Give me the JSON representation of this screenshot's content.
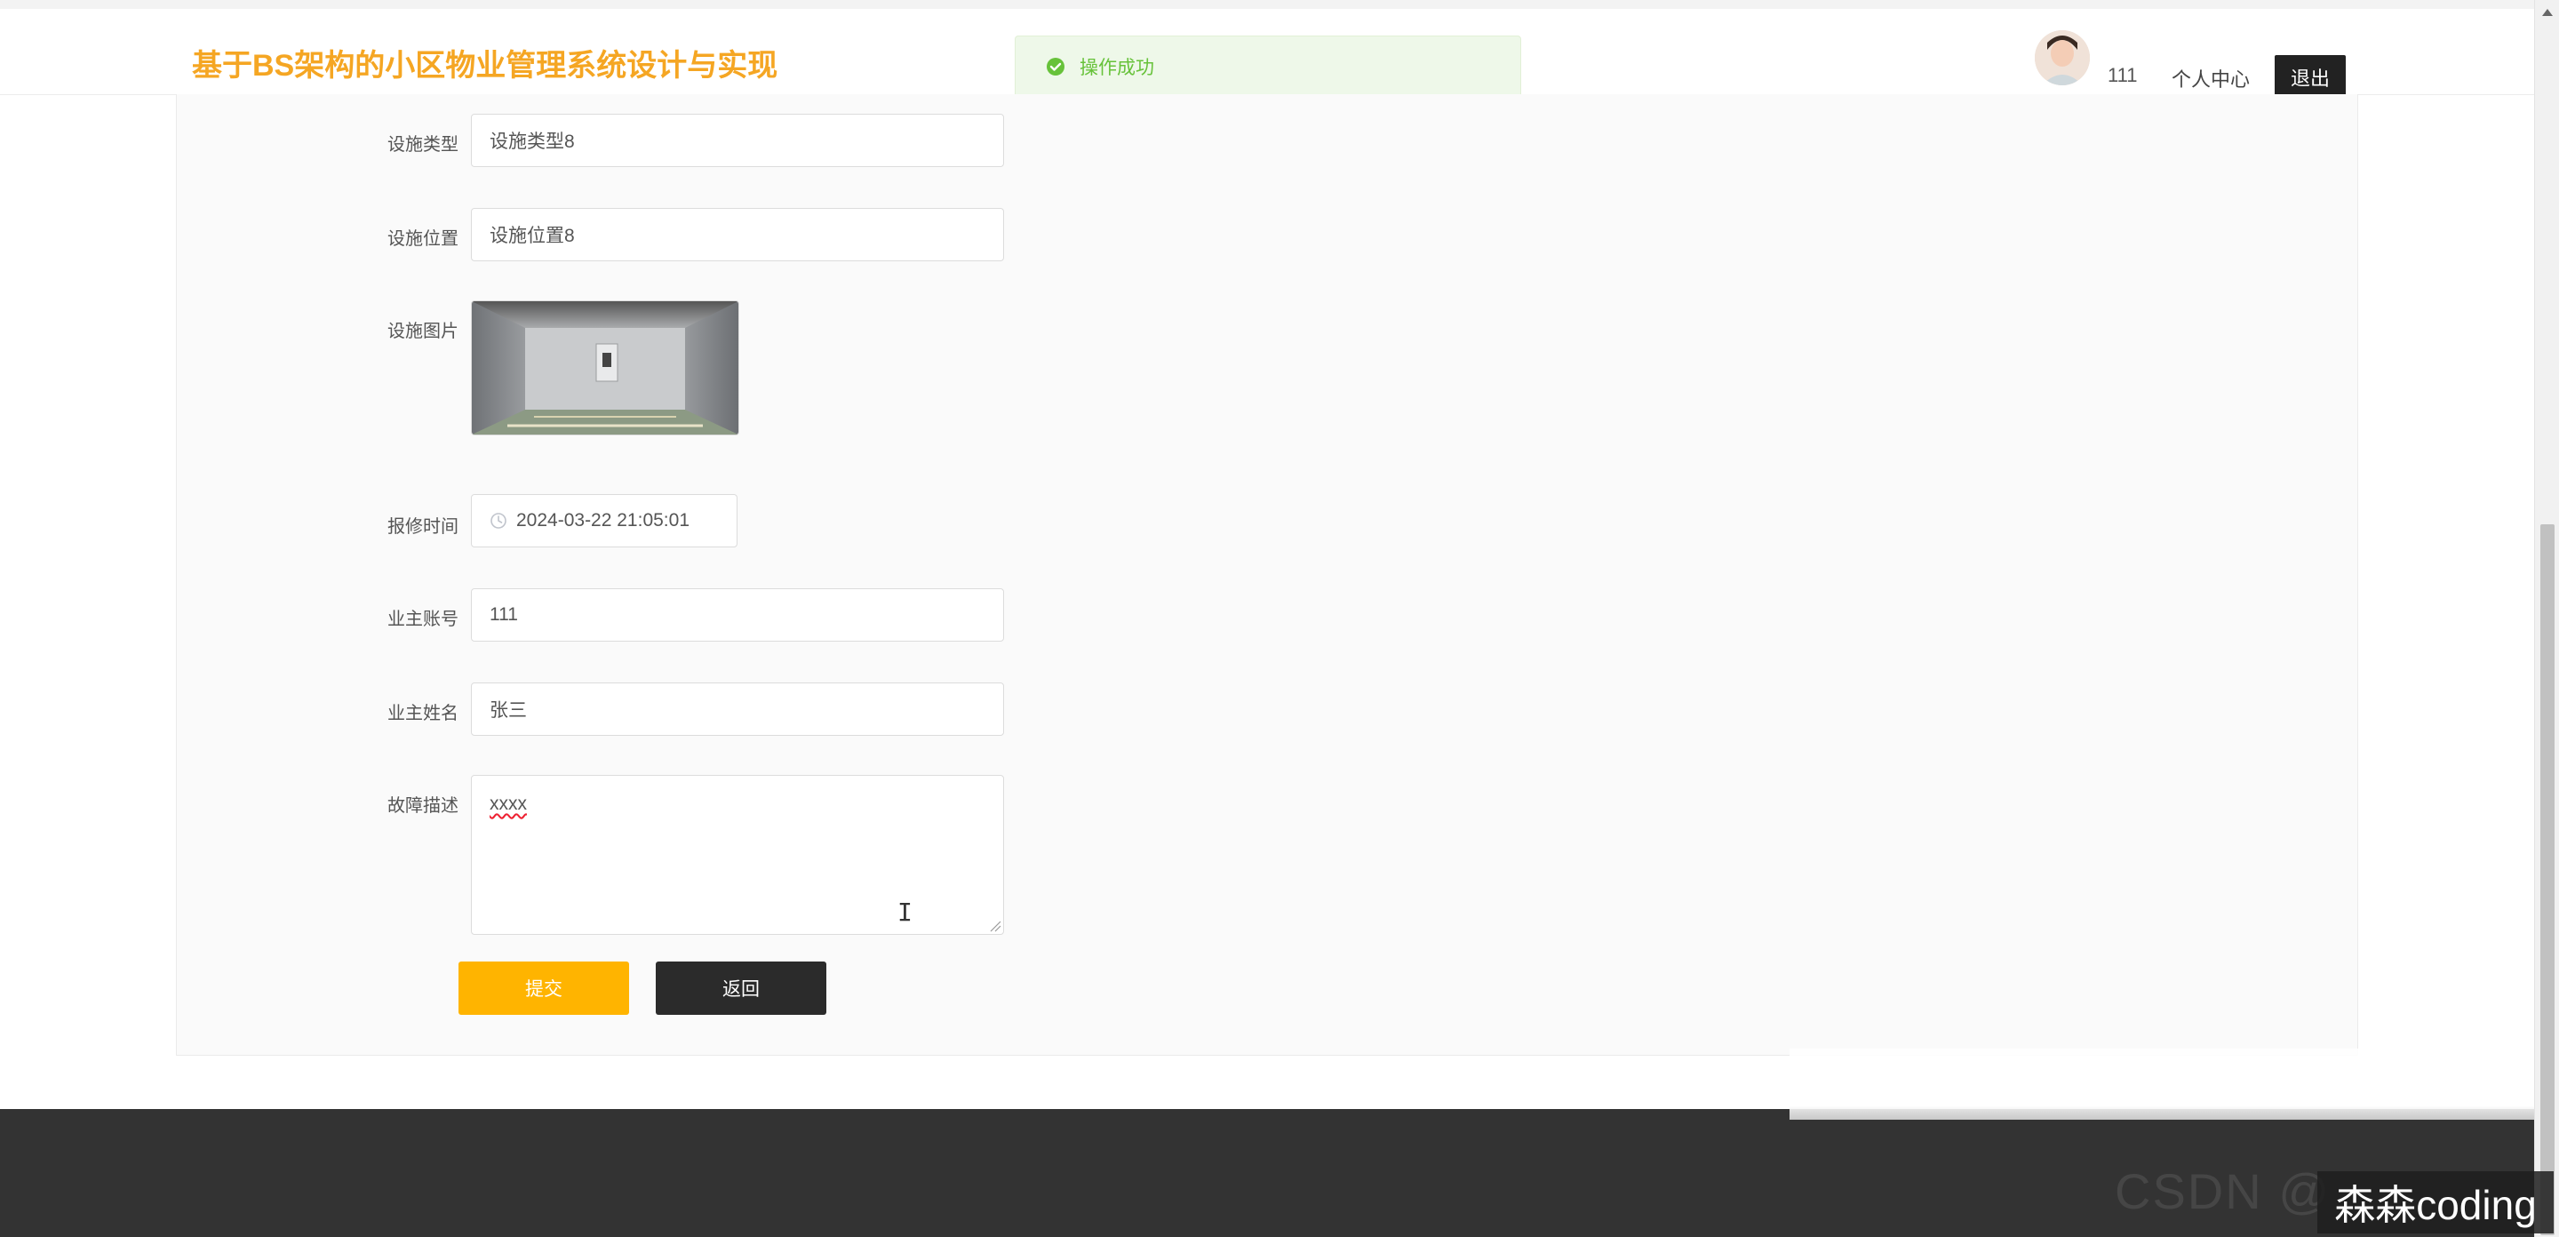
{
  "header": {
    "site_title": "基于BS架构的小区物业管理系统设计与实现",
    "username": "111",
    "profile_link": "个人中心",
    "logout_label": "退出"
  },
  "toast": {
    "message": "操作成功",
    "color": "#67c23a"
  },
  "form": {
    "facility_type": {
      "label": "设施类型",
      "value": "设施类型8"
    },
    "facility_location": {
      "label": "设施位置",
      "value": "设施位置8"
    },
    "facility_image": {
      "label": "设施图片"
    },
    "repair_time": {
      "label": "报修时间",
      "value": "2024-03-22 21:05:01"
    },
    "owner_account": {
      "label": "业主账号",
      "value": "111"
    },
    "owner_name": {
      "label": "业主姓名",
      "value": "张三"
    },
    "fault_description": {
      "label": "故障描述",
      "value": "xxxx"
    },
    "submit_label": "提交",
    "back_label": "返回"
  },
  "watermark": {
    "text": "森森coding",
    "blurred": "CSDN @"
  },
  "colors": {
    "accent": "#f5a623",
    "submit": "#ffb400",
    "dark": "#2b2b2b"
  },
  "icons": [
    "success-icon",
    "clock-icon",
    "avatar-image",
    "elevator-image"
  ]
}
